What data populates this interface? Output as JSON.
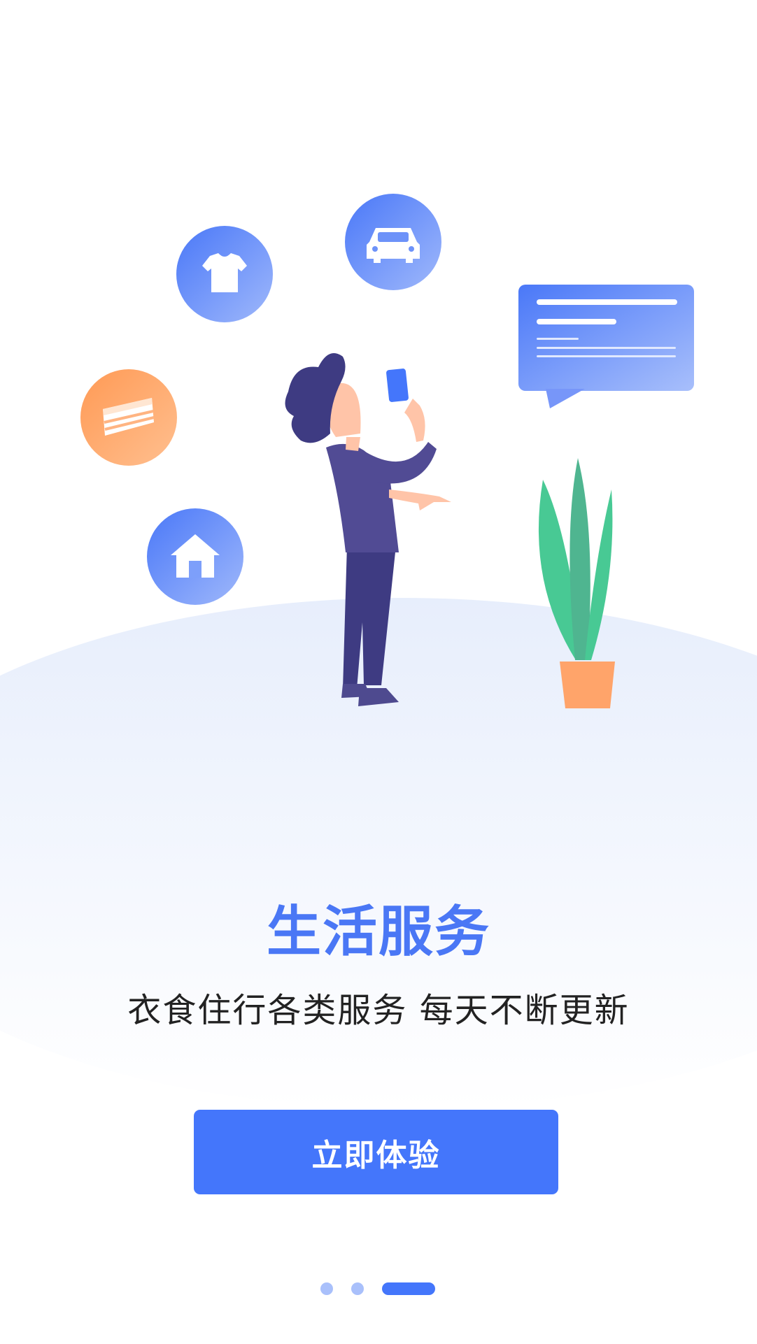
{
  "intro": {
    "title": "生活服务",
    "subtitle": "衣食住行各类服务 每天不断更新",
    "cta_label": "立即体验"
  },
  "pager": {
    "total": 3,
    "active_index": 2
  },
  "illustration": {
    "service_icons": [
      "shirt-icon",
      "car-icon",
      "cake-icon",
      "house-icon"
    ]
  },
  "colors": {
    "primary": "#4476fb",
    "title": "#4a77f5",
    "orange": "#ffa46a",
    "plant": "#48c994",
    "figure": "#3e3b82"
  }
}
